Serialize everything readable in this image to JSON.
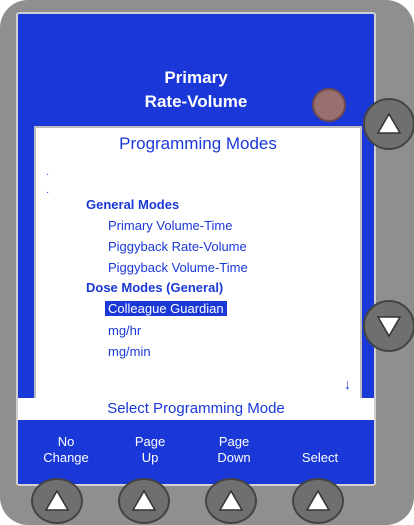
{
  "header": {
    "line1": "Primary",
    "line2": "Rate-Volume"
  },
  "panel": {
    "title": "Programming Modes",
    "sections": [
      {
        "heading": "General Modes",
        "items": [
          "Primary Volume-Time",
          "Piggyback Rate-Volume",
          "Piggyback Volume-Time"
        ]
      },
      {
        "heading": "Dose Modes (General)",
        "items": [
          "Colleague Guardian",
          "mg/hr",
          "mg/min"
        ]
      }
    ],
    "selected_item": "Colleague Guardian",
    "more_indicator": "↓"
  },
  "prompt": "Select Programming Mode",
  "softkeys": [
    {
      "line1": "No",
      "line2": "Change"
    },
    {
      "line1": "Page",
      "line2": "Up"
    },
    {
      "line1": "Page",
      "line2": "Down"
    },
    {
      "line1": "",
      "line2": "Select"
    }
  ],
  "icons": {
    "hardware_button": "triangle-up-icon",
    "side_up": "triangle-up-icon",
    "side_down": "triangle-down-icon",
    "status": "status-light-icon"
  },
  "colors": {
    "screen_blue": "#1a38d8",
    "device_gray": "#8f8f8f",
    "status_light": "#9a6f6f"
  }
}
